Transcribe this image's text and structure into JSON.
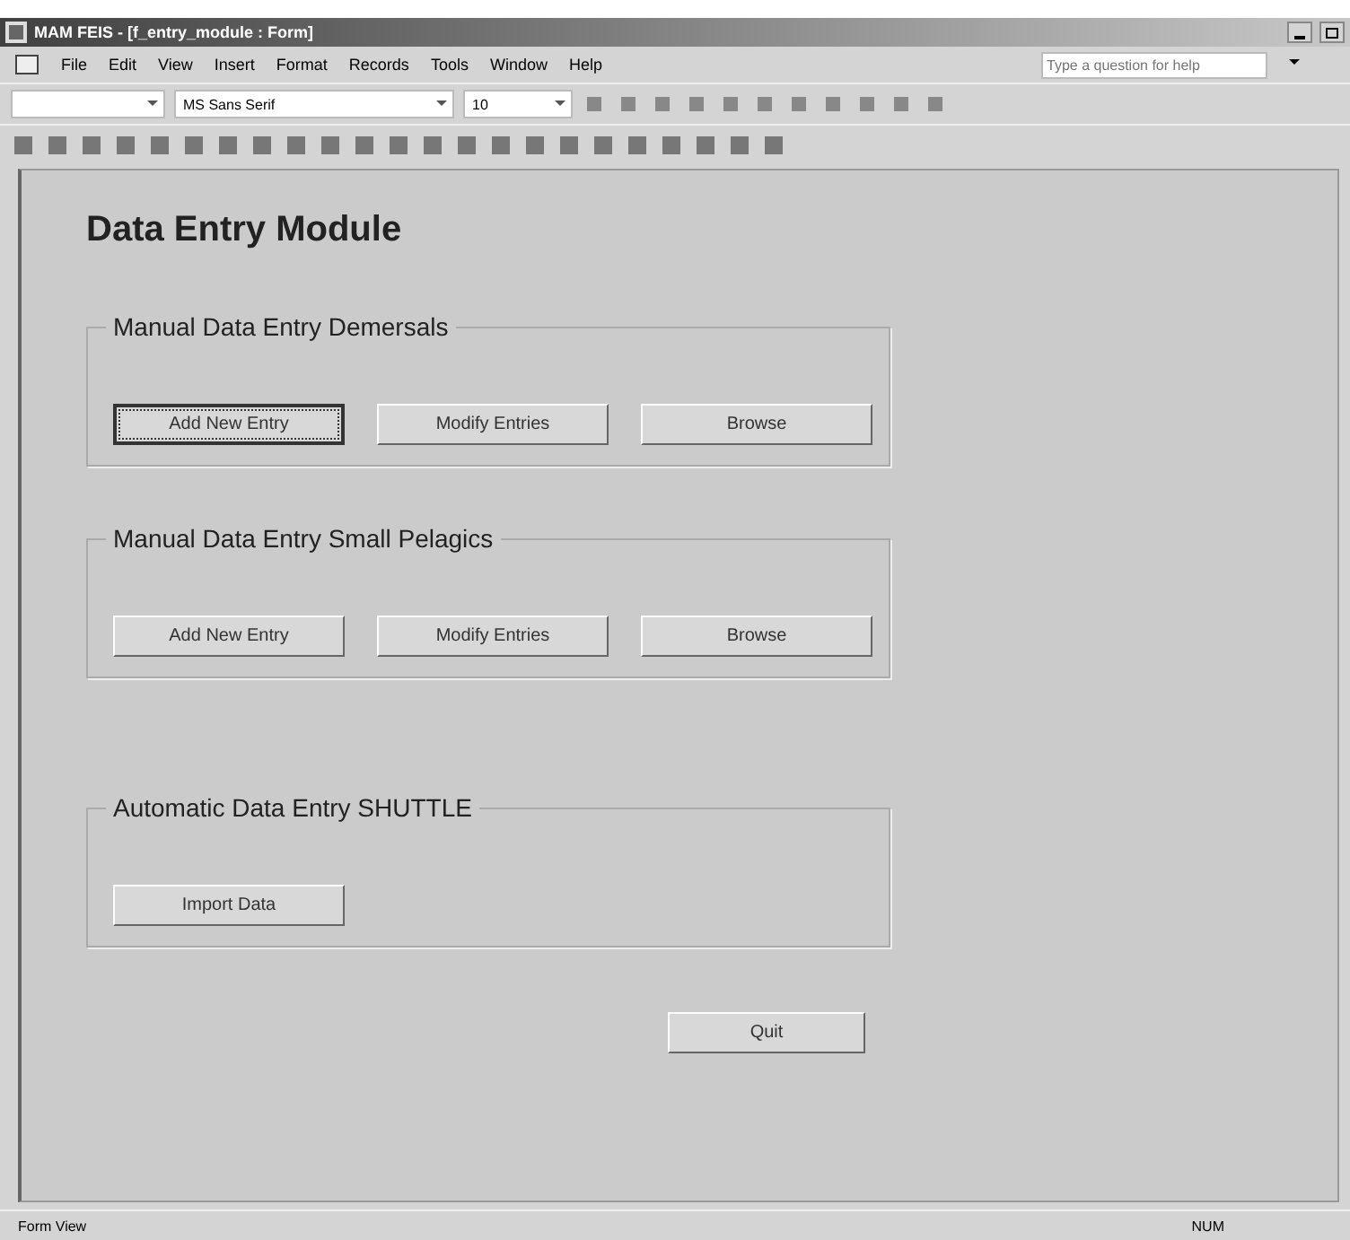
{
  "window": {
    "title": "MAM FEIS - [f_entry_module : Form]"
  },
  "menu": [
    "File",
    "Edit",
    "View",
    "Insert",
    "Format",
    "Records",
    "Tools",
    "Window",
    "Help"
  ],
  "help_box": {
    "placeholder": "Type a question for help"
  },
  "format_toolbar": {
    "font": "MS Sans Serif",
    "size": "10"
  },
  "form": {
    "heading": "Data Entry Module",
    "groups": [
      {
        "label": "Manual Data Entry Demersals",
        "buttons": [
          {
            "label": "Add New Entry",
            "focused": true
          },
          {
            "label": "Modify Entries",
            "focused": false
          },
          {
            "label": "Browse",
            "focused": false
          }
        ]
      },
      {
        "label": "Manual Data Entry Small Pelagics",
        "buttons": [
          {
            "label": "Add New Entry",
            "focused": false
          },
          {
            "label": "Modify Entries",
            "focused": false
          },
          {
            "label": "Browse",
            "focused": false
          }
        ]
      },
      {
        "label": "Automatic Data Entry SHUTTLE",
        "buttons": [
          {
            "label": "Import Data",
            "focused": false
          }
        ]
      }
    ],
    "quit_button": "Quit"
  },
  "status_bar": {
    "view": "Form View",
    "num": "NUM"
  }
}
